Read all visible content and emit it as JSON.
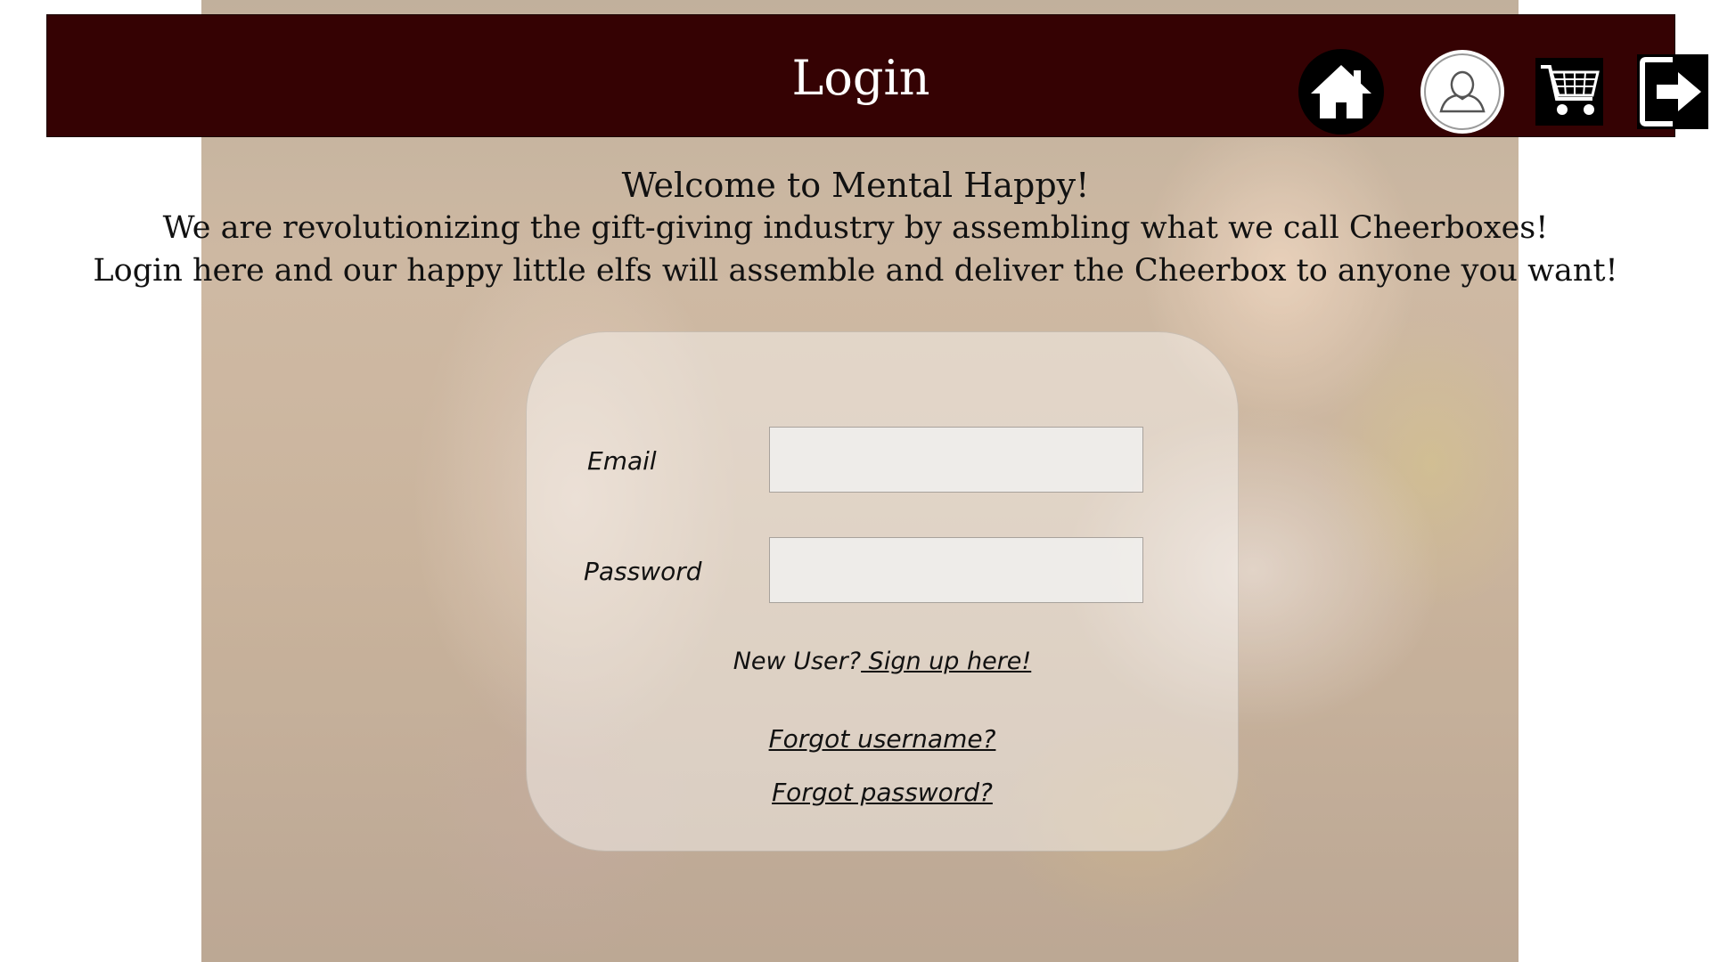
{
  "header": {
    "title": "Login",
    "icons": [
      "home-icon",
      "user-icon",
      "cart-icon",
      "logout-icon"
    ],
    "background_color": "#350203"
  },
  "intro": {
    "line1": "Welcome to Mental Happy!",
    "line2": "We are revolutionizing the gift-giving industry by assembling what we call Cheerboxes!",
    "line3": "Login here and our happy little elfs will assemble and deliver the Cheerbox to anyone you want!"
  },
  "form": {
    "email_label": "Email",
    "email_value": "",
    "password_label": "Password",
    "password_value": "",
    "new_user_text": "New User?",
    "signup_link": " Sign up here!",
    "forgot_username": "Forgot username?",
    "forgot_password": "Forgot password?"
  }
}
